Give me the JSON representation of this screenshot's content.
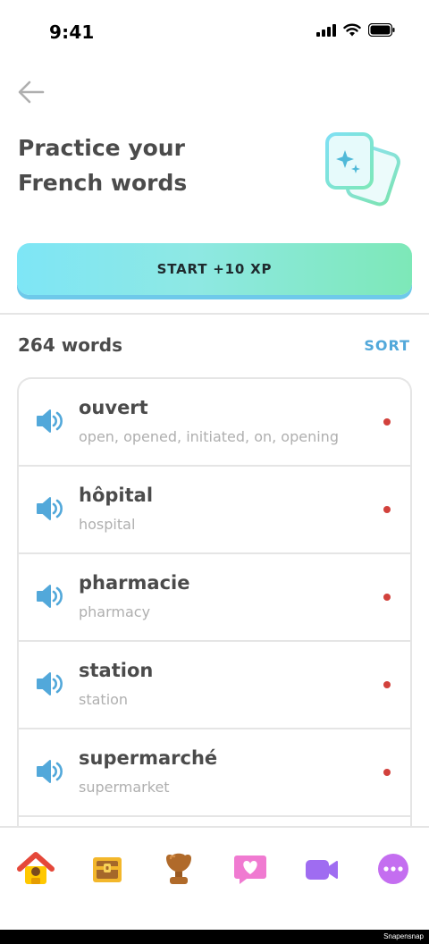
{
  "status": {
    "time": "9:41"
  },
  "header": {
    "title_line1": "Practice your",
    "title_line2": "French words"
  },
  "start_button": {
    "label": "START +10 XP"
  },
  "words_section": {
    "count_label": "264 words",
    "sort_label": "SORT"
  },
  "words": [
    {
      "word": "ouvert",
      "translation": "open, opened, initiated, on, opening"
    },
    {
      "word": "hôpital",
      "translation": "hospital"
    },
    {
      "word": "pharmacie",
      "translation": "pharmacy"
    },
    {
      "word": "station",
      "translation": "station"
    },
    {
      "word": "supermarché",
      "translation": "supermarket"
    },
    {
      "word": "",
      "translation": ""
    }
  ],
  "tabs": [
    {
      "icon": "home-icon"
    },
    {
      "icon": "treasure-chest-icon"
    },
    {
      "icon": "trophy-icon"
    },
    {
      "icon": "heart-chat-icon"
    },
    {
      "icon": "video-icon"
    },
    {
      "icon": "more-icon"
    }
  ],
  "footer": {
    "watermark": "Snapensnap"
  },
  "colors": {
    "accent": "#52a8da",
    "dot": "#d2413c",
    "text": "#4b4b4b",
    "muted": "#afafaf",
    "border": "#e5e5e5"
  }
}
